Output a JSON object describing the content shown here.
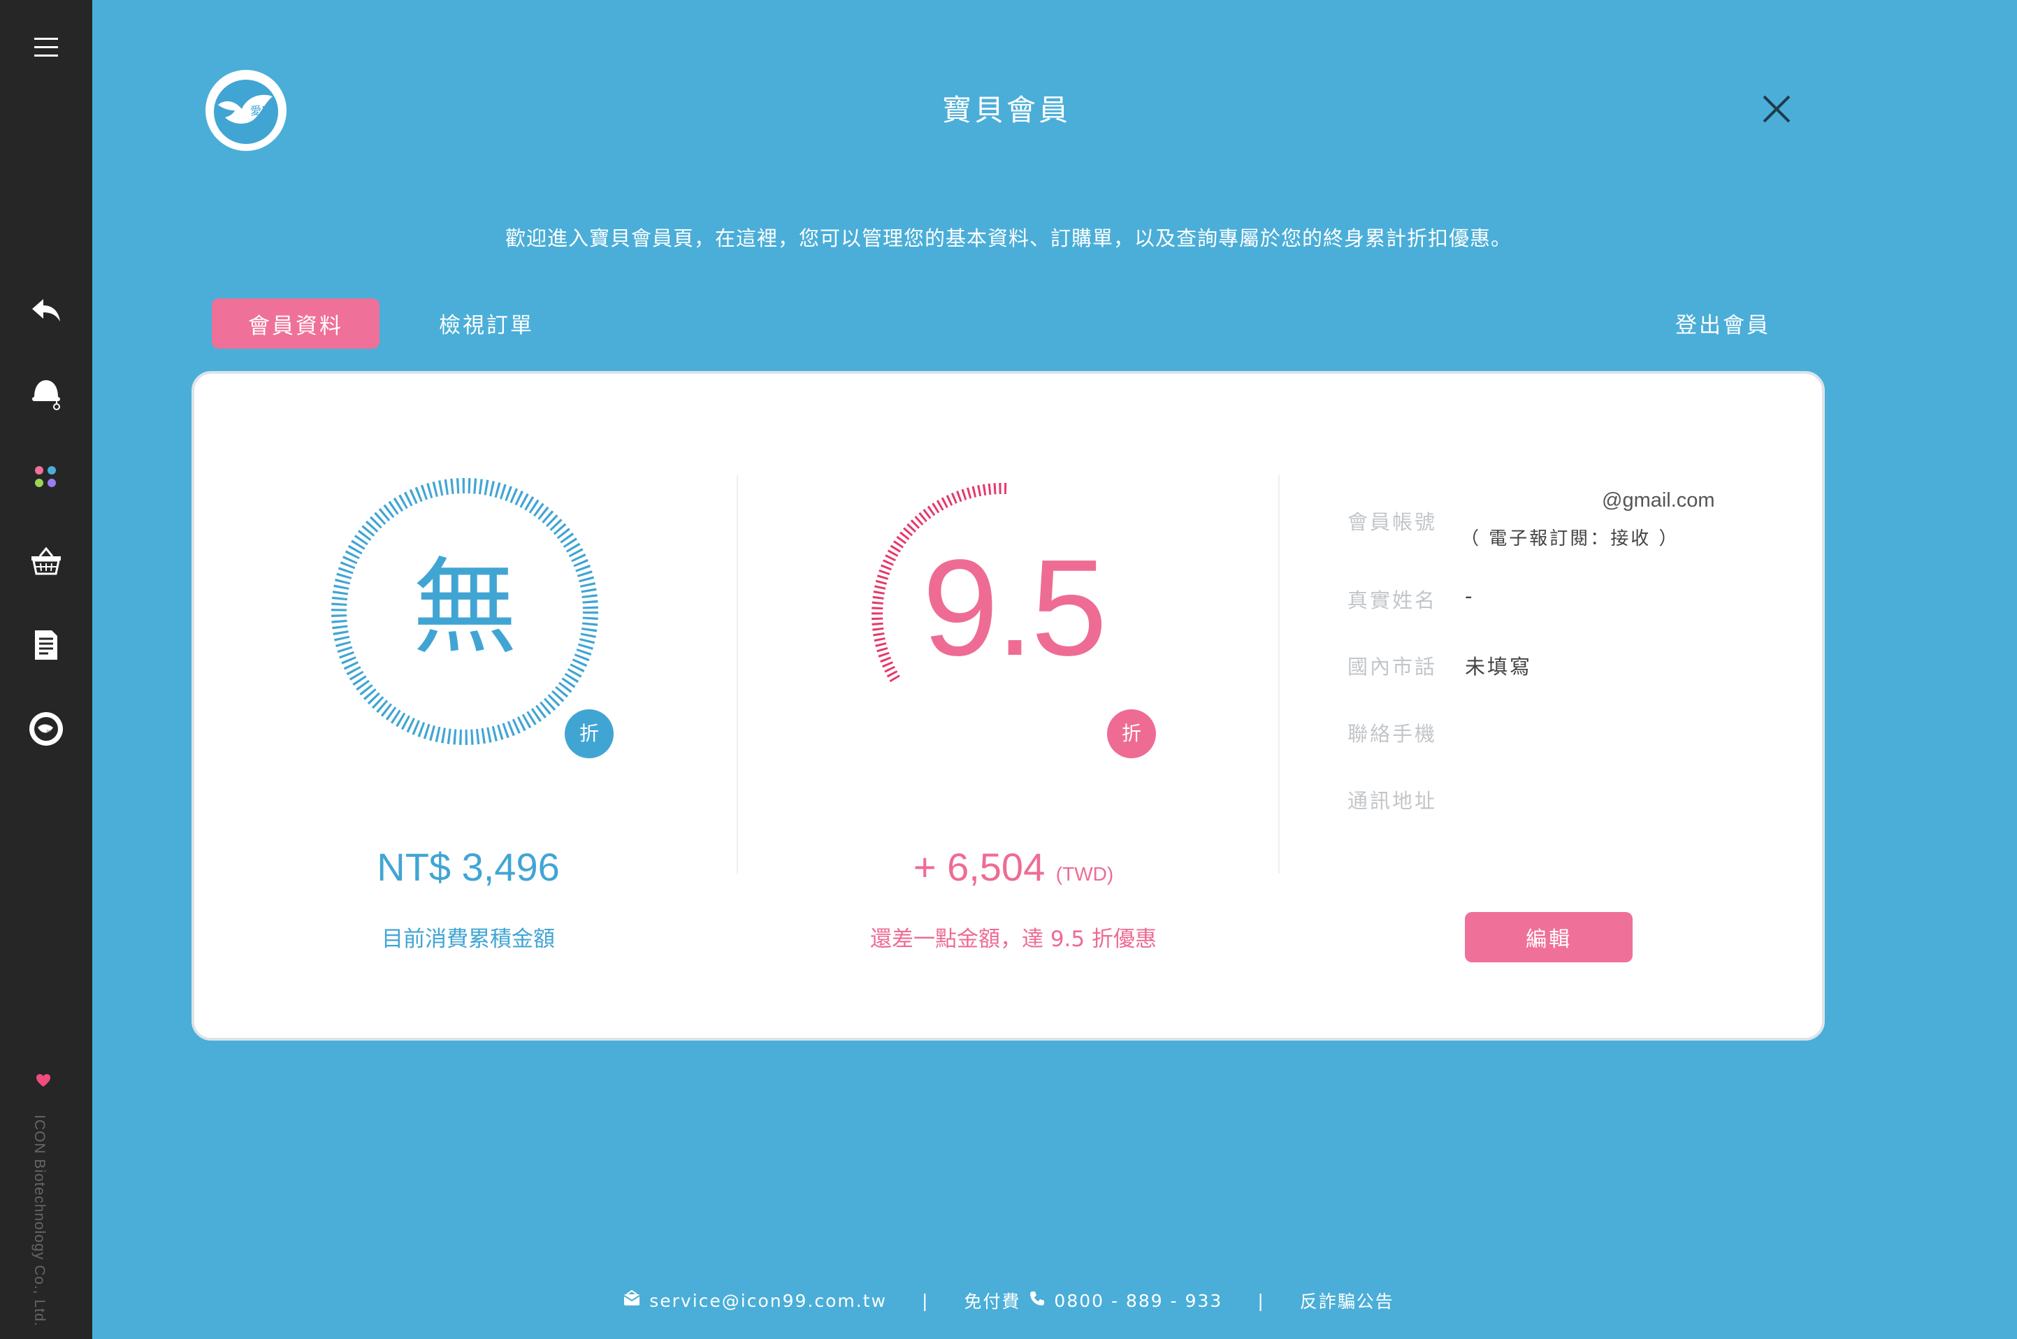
{
  "header": {
    "title": "寶貝會員",
    "welcome": "歡迎進入寶貝會員頁，在這裡，您可以管理您的基本資料、訂購單，以及查詢專屬於您的終身累計折扣優惠。",
    "logo_text": "愛康",
    "logo_sub": "ICON"
  },
  "tabs": {
    "active": "會員資料",
    "orders": "檢視訂單",
    "logout": "登出會員"
  },
  "current_discount": {
    "value": "無",
    "badge": "折",
    "amount": "NT$ 3,496",
    "label": "目前消費累積金額",
    "color": "#41a5d4"
  },
  "next_discount": {
    "value": "9.5",
    "badge": "折",
    "amount": "+ 6,504",
    "currency": "(TWD)",
    "label": "還差一點金額，達 9.5 折優惠",
    "color": "#ee6c94"
  },
  "member": {
    "account_label": "會員帳號",
    "account_value": "@gmail.com",
    "newsletter": "（ 電子報訂閱：接收 ）",
    "name_label": "真實姓名",
    "name_value": "-",
    "phone_label": "國內市話",
    "phone_value": "未填寫",
    "mobile_label": "聯絡手機",
    "mobile_value": "",
    "address_label": "通訊地址",
    "address_value": "",
    "edit_label": "編輯"
  },
  "footer": {
    "email": "service@icon99.com.tw",
    "tollfree_label": "免付費",
    "phone": "0800 - 889 - 933",
    "fraud": "反詐騙公告",
    "separator": "|"
  },
  "sidebar": {
    "company": "ICON Biotechnology Co., Ltd."
  },
  "icons": [
    "menu-icon",
    "back-icon",
    "user-cap-icon",
    "dots-grid-icon",
    "basket-icon",
    "document-icon",
    "icon-logo-icon",
    "heart-icon",
    "mail-icon",
    "phone-icon",
    "close-icon"
  ]
}
